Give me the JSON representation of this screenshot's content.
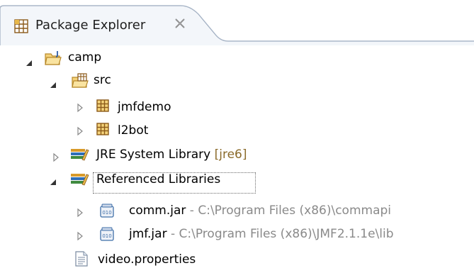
{
  "view": {
    "title": "Package Explorer",
    "close_glyph": "⌧"
  },
  "tree": {
    "project": {
      "label": "camp",
      "icon": "java-project-icon",
      "expanded": true
    },
    "src": {
      "label": "src",
      "icon": "source-folder-icon",
      "expanded": true
    },
    "packages": [
      {
        "label": "jmfdemo",
        "icon": "package-icon"
      },
      {
        "label": "l2bot",
        "icon": "package-icon"
      }
    ],
    "jre": {
      "label": "JRE System Library",
      "decoration": "[jre6]",
      "icon": "library-icon"
    },
    "ref_libs": {
      "label": "Referenced Libraries",
      "icon": "library-icon",
      "expanded": true,
      "selected": true
    },
    "jars": [
      {
        "name": "comm.jar",
        "path": " - C:\\Program Files (x86)\\commapi",
        "icon": "jar-icon"
      },
      {
        "name": "jmf.jar",
        "path": " - C:\\Program Files (x86)\\JMF2.1.1e\\lib",
        "icon": "jar-icon"
      }
    ],
    "file": {
      "label": "video.properties",
      "icon": "properties-file-icon"
    }
  },
  "colors": {
    "border": "#a9b6c8",
    "package_brown": "#8b5a1a",
    "folder_gold": "#e8b84a",
    "library_green": "#3f8a3f",
    "jar_blue": "#3f6fa8"
  }
}
